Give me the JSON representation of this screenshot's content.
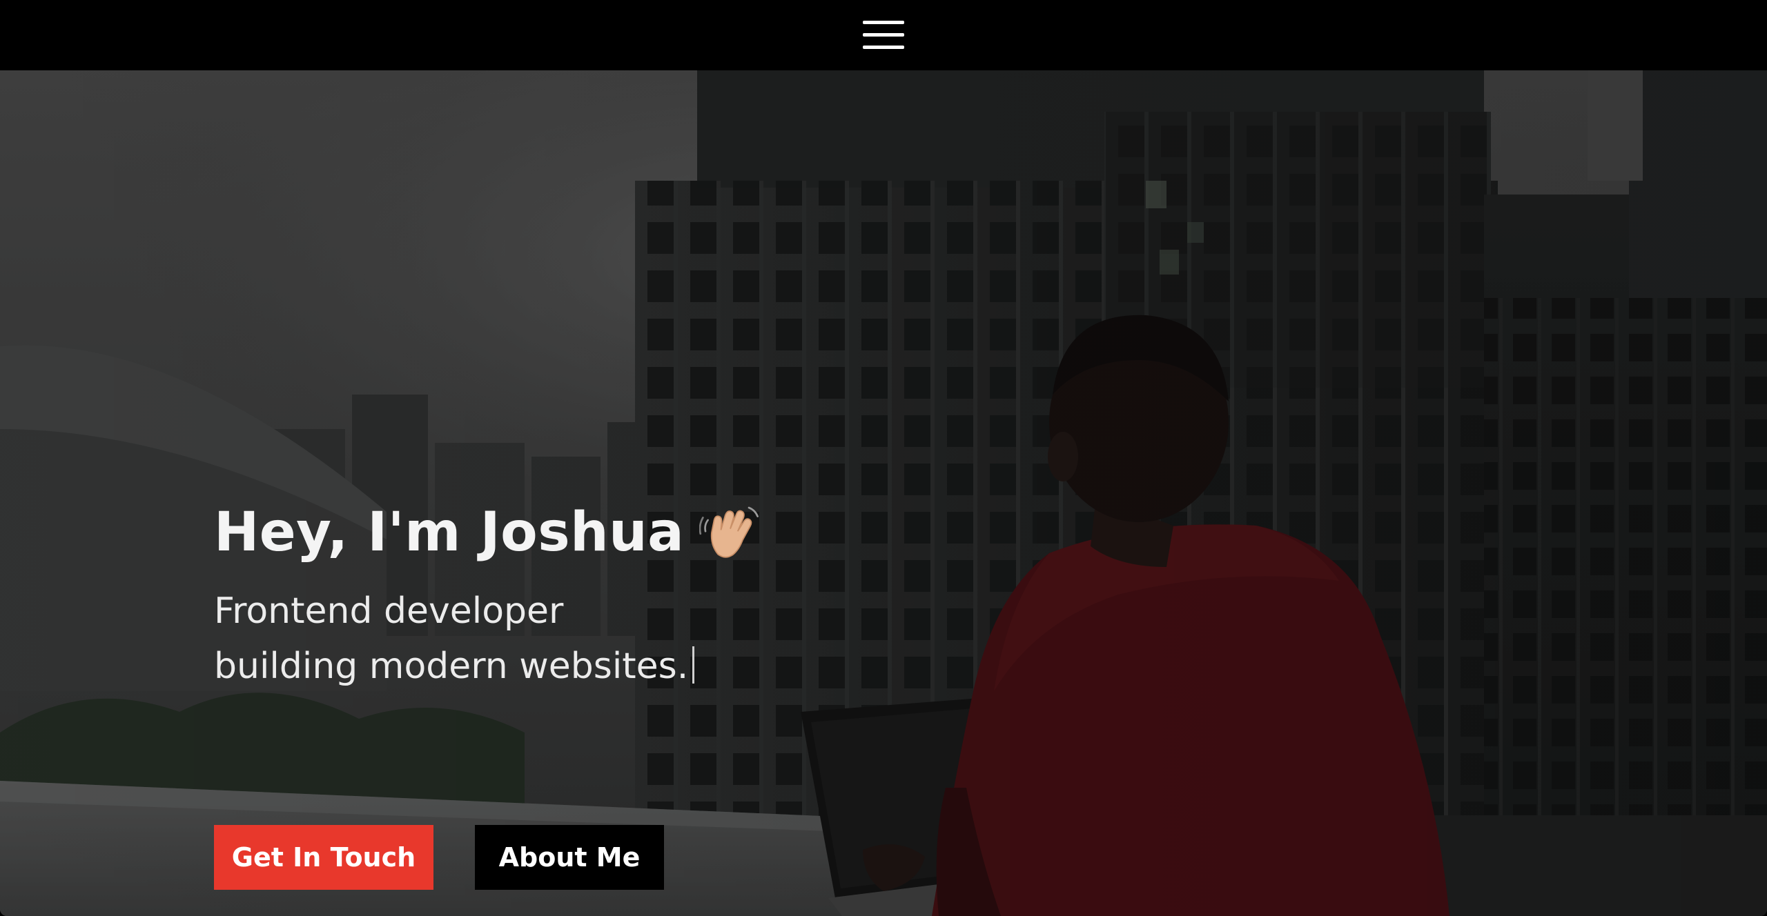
{
  "nav": {
    "menu_icon": "hamburger-menu-icon"
  },
  "hero": {
    "heading": "Hey, I'm Joshua",
    "heading_emoji_icon": "waving-hand-icon",
    "subtitle_line1": "Frontend developer",
    "subtitle_line2": "building modern websites.",
    "primary_button": "Get In Touch",
    "secondary_button": "About Me"
  },
  "colors": {
    "accent": "#e8382c",
    "nav_background": "#000000",
    "secondary_button": "#000000",
    "text": "#f4f4f4"
  }
}
